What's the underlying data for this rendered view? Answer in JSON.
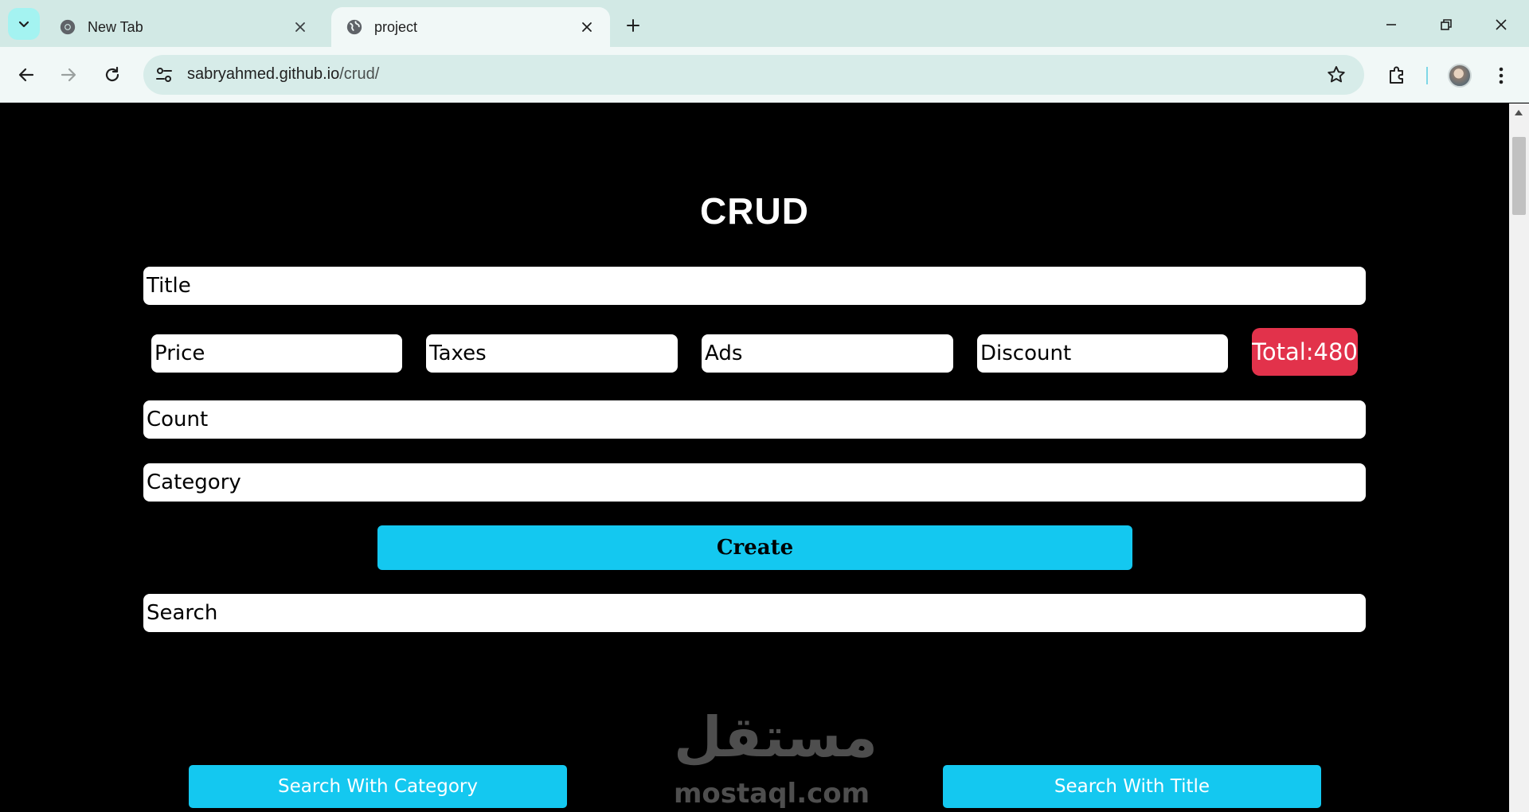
{
  "browser": {
    "tabs": [
      {
        "title": "New Tab",
        "active": false
      },
      {
        "title": "project",
        "active": true
      }
    ],
    "url_host": "sabryahmed.github.io",
    "url_path": "/crud/",
    "accent": "#a4f3f1"
  },
  "page": {
    "heading": "CRUD",
    "title_placeholder": "Title",
    "price_placeholder": "Price",
    "taxes_placeholder": "Taxes",
    "ads_placeholder": "Ads",
    "discount_placeholder": "Discount",
    "total_label": "Total:480",
    "count_placeholder": "Count",
    "category_placeholder": "Category",
    "create_label": "Create",
    "search_placeholder": "Search",
    "search_category_label": "Search With Category",
    "search_title_label": "Search With Title",
    "total_color": "#e2324b",
    "button_color": "#14c8f0"
  },
  "watermark": {
    "arabic": "مستقل",
    "latin": "mostaql.com"
  }
}
